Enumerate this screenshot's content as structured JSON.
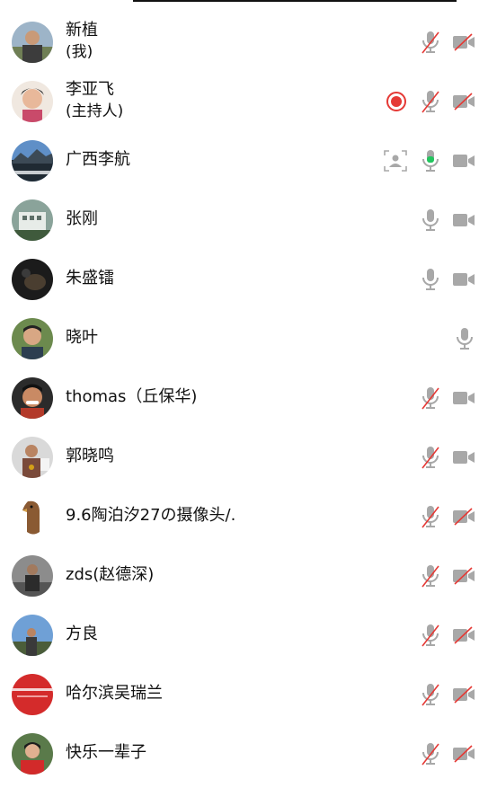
{
  "colors": {
    "icon_gray": "#a8a8a8",
    "muted_slash": "#e53935",
    "speaking_green": "#22c55e",
    "record_red": "#e53935"
  },
  "participants": [
    {
      "name": "新植",
      "role": "(我)",
      "avatar": "avatar-man-outdoor",
      "mic": "muted",
      "camera": "off"
    },
    {
      "name": "李亚飞",
      "role": "(主持人)",
      "avatar": "avatar-woman-portrait",
      "recording": true,
      "mic": "muted",
      "camera": "off"
    },
    {
      "name": "广西李航",
      "avatar": "avatar-mountain-landscape",
      "speaker_view": true,
      "mic": "speaking",
      "camera": "on"
    },
    {
      "name": "张刚",
      "avatar": "avatar-buildings",
      "mic": "on",
      "camera": "on"
    },
    {
      "name": "朱盛镭",
      "avatar": "avatar-dark-photo",
      "mic": "on",
      "camera": "on"
    },
    {
      "name": "晓叶",
      "avatar": "avatar-man-portrait",
      "mic": "on",
      "camera": "none"
    },
    {
      "name": "thomas（丘保华)",
      "avatar": "avatar-man-laughing",
      "mic": "muted",
      "camera": "on"
    },
    {
      "name": "郭晓鸣",
      "avatar": "avatar-man-medal",
      "mic": "muted",
      "camera": "on"
    },
    {
      "name": "9.6陶泊汐27の摄像头/.",
      "avatar": "avatar-bird-figure",
      "mic": "muted",
      "camera": "off"
    },
    {
      "name": "zds(赵德深)",
      "avatar": "avatar-man-gray",
      "mic": "muted",
      "camera": "off"
    },
    {
      "name": "方良",
      "avatar": "avatar-man-sky",
      "mic": "muted",
      "camera": "off"
    },
    {
      "name": "哈尔滨吴瑞兰",
      "avatar": "avatar-red-banner",
      "mic": "muted",
      "camera": "off"
    },
    {
      "name": "快乐一辈子",
      "avatar": "avatar-woman-red",
      "mic": "muted",
      "camera": "off"
    }
  ]
}
